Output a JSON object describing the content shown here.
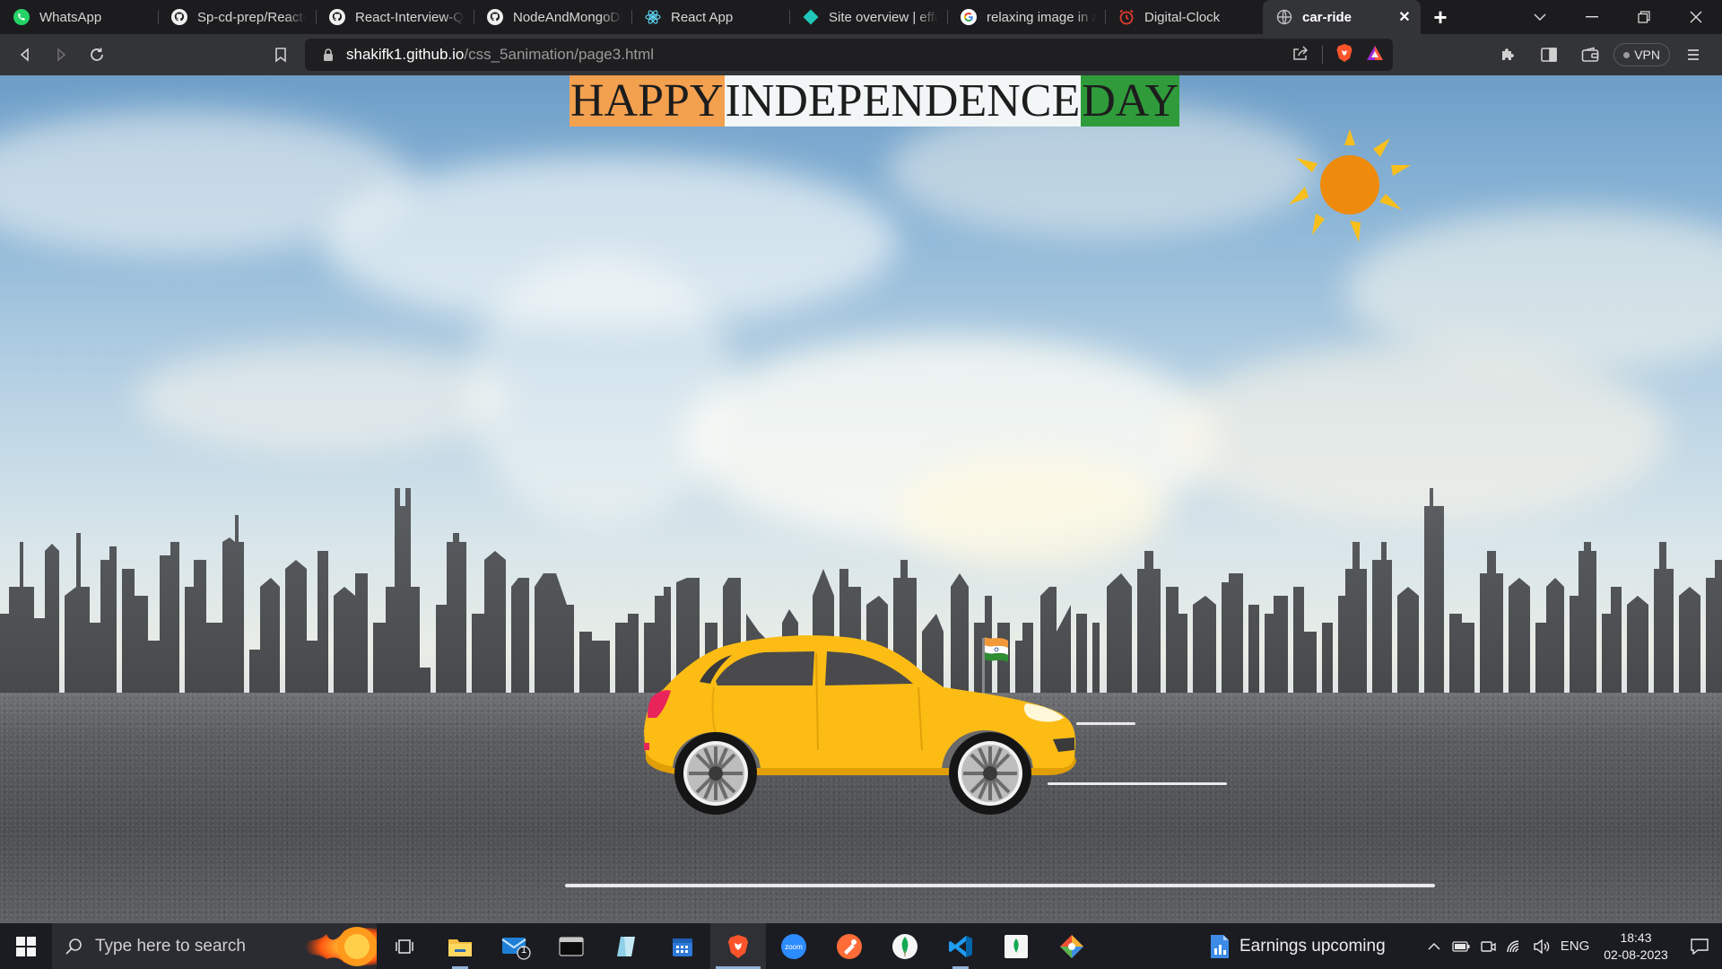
{
  "browser": {
    "tabs": [
      {
        "title": "WhatsApp",
        "icon": "whatsapp-icon"
      },
      {
        "title": "Sp-cd-prep/React-N",
        "icon": "github-icon"
      },
      {
        "title": "React-Interview-Qn",
        "icon": "github-icon"
      },
      {
        "title": "NodeAndMongoDB",
        "icon": "github-icon"
      },
      {
        "title": "React App",
        "icon": "react-icon"
      },
      {
        "title": "Site overview | effu",
        "icon": "netlify-icon"
      },
      {
        "title": "relaxing image in ar",
        "icon": "google-icon"
      },
      {
        "title": "Digital-Clock",
        "icon": "alarm-clock-icon"
      },
      {
        "title": "car-ride",
        "icon": "globe-icon",
        "active": true
      }
    ],
    "address": {
      "host": "shakifk1.github.io",
      "path": "/css_5animation/page3.html"
    },
    "vpn_label": "VPN"
  },
  "page": {
    "headline": [
      "HAPPY",
      "INDEPENDENCE",
      "DAY"
    ],
    "colors": {
      "saffron": "#f3a04f",
      "white": "#f2f6f7",
      "green": "#2f9b3a",
      "sun": "#ee8a0c",
      "sun_rays": "#f8bf1c",
      "car_body": "#fcbc14"
    }
  },
  "taskbar": {
    "search_placeholder": "Type here to search",
    "apps": [
      "task-view-icon",
      "file-explorer-icon",
      "mail-icon",
      "terminal-icon",
      "notes-icon",
      "calendar-icon",
      "brave-icon",
      "zoom-icon",
      "postman-icon",
      "mongodb-icon",
      "vscode-icon",
      "mongodb-compass-icon",
      "git-icon"
    ],
    "mail_badge": "1",
    "zoom_label": "zoom",
    "widget_text": "Earnings upcoming",
    "language": "ENG",
    "time": "18:43",
    "date": "02-08-2023"
  }
}
